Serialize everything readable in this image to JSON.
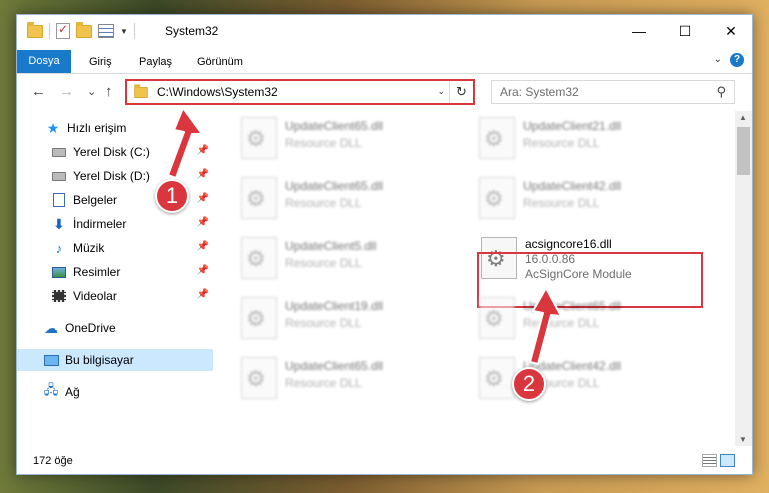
{
  "window": {
    "title": "System32",
    "min_glyph": "—",
    "max_glyph": "☐",
    "close_glyph": "✕"
  },
  "ribbon": {
    "tabs": [
      "Dosya",
      "Giriş",
      "Paylaş",
      "Görünüm"
    ],
    "help": "?"
  },
  "nav": {
    "back": "←",
    "forward": "→",
    "recent": "⌄",
    "up": "↑"
  },
  "address": {
    "path": "C:\\Windows\\System32",
    "refresh_glyph": "↻"
  },
  "search": {
    "placeholder": "Ara: System32",
    "icon": "⚲"
  },
  "sidebar": {
    "items": [
      {
        "label": "Hızlı erişim",
        "icon": "star-icon"
      },
      {
        "label": "Yerel Disk (C:)",
        "icon": "drive-icon",
        "pinned": true
      },
      {
        "label": "Yerel Disk (D:)",
        "icon": "drive-icon",
        "pinned": true
      },
      {
        "label": "Belgeler",
        "icon": "document-icon",
        "pinned": true
      },
      {
        "label": "İndirmeler",
        "icon": "download-icon",
        "pinned": true
      },
      {
        "label": "Müzik",
        "icon": "music-icon",
        "pinned": true
      },
      {
        "label": "Resimler",
        "icon": "pictures-icon",
        "pinned": true
      },
      {
        "label": "Videolar",
        "icon": "videos-icon",
        "pinned": true
      },
      {
        "label": "OneDrive",
        "icon": "cloud-icon"
      },
      {
        "label": "Bu bilgisayar",
        "icon": "computer-icon",
        "selected": true
      },
      {
        "label": "Ağ",
        "icon": "network-icon"
      }
    ]
  },
  "files": [
    {
      "name": "UpdateClient65.dll",
      "type": "Resource DLL"
    },
    {
      "name": "UpdateClient21.dll",
      "type": "Resource DLL"
    },
    {
      "name": "UpdateClient65.dll",
      "type": "Resource DLL"
    },
    {
      "name": "UpdateClient42.dll",
      "type": "Resource DLL"
    },
    {
      "name": "UpdateClient5.dll",
      "type": "Resource DLL"
    },
    {
      "name": "acsigncore16.dll",
      "version": "16.0.0.86",
      "type": "AcSignCore Module"
    },
    {
      "name": "UpdateClient19.dll",
      "type": "Resource DLL"
    },
    {
      "name": "UpdateClient65.dll",
      "type": "Resource DLL"
    },
    {
      "name": "UpdateClient65.dll",
      "type": "Resource DLL"
    },
    {
      "name": "UpdateClient42.dll",
      "type": "Resource DLL"
    }
  ],
  "status": {
    "count": "172 öğe"
  },
  "annotations": {
    "badge1": "1",
    "badge2": "2",
    "color": "#d9363e"
  }
}
